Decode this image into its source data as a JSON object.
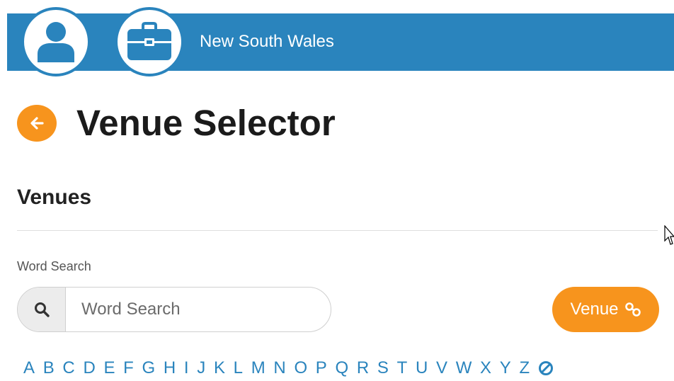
{
  "colors": {
    "brand": "#2a84bd",
    "accent": "#f7941d",
    "link": "#2a84bd"
  },
  "header": {
    "org_name": "New South Wales",
    "profile_icon": "user-icon",
    "work_icon": "briefcase-icon"
  },
  "page": {
    "back_icon": "arrow-left-icon",
    "title": "Venue Selector"
  },
  "venues": {
    "section_title": "Venues",
    "search": {
      "label": "Word Search",
      "placeholder": "Word Search",
      "value": "",
      "icon": "search-icon"
    },
    "venue_button": {
      "label": "Venue",
      "icon": "link-icon"
    },
    "alphabet": [
      "A",
      "B",
      "C",
      "D",
      "E",
      "F",
      "G",
      "H",
      "I",
      "J",
      "K",
      "L",
      "M",
      "N",
      "O",
      "P",
      "Q",
      "R",
      "S",
      "T",
      "U",
      "V",
      "W",
      "X",
      "Y",
      "Z"
    ],
    "clear_icon": "clear-filter-icon"
  }
}
